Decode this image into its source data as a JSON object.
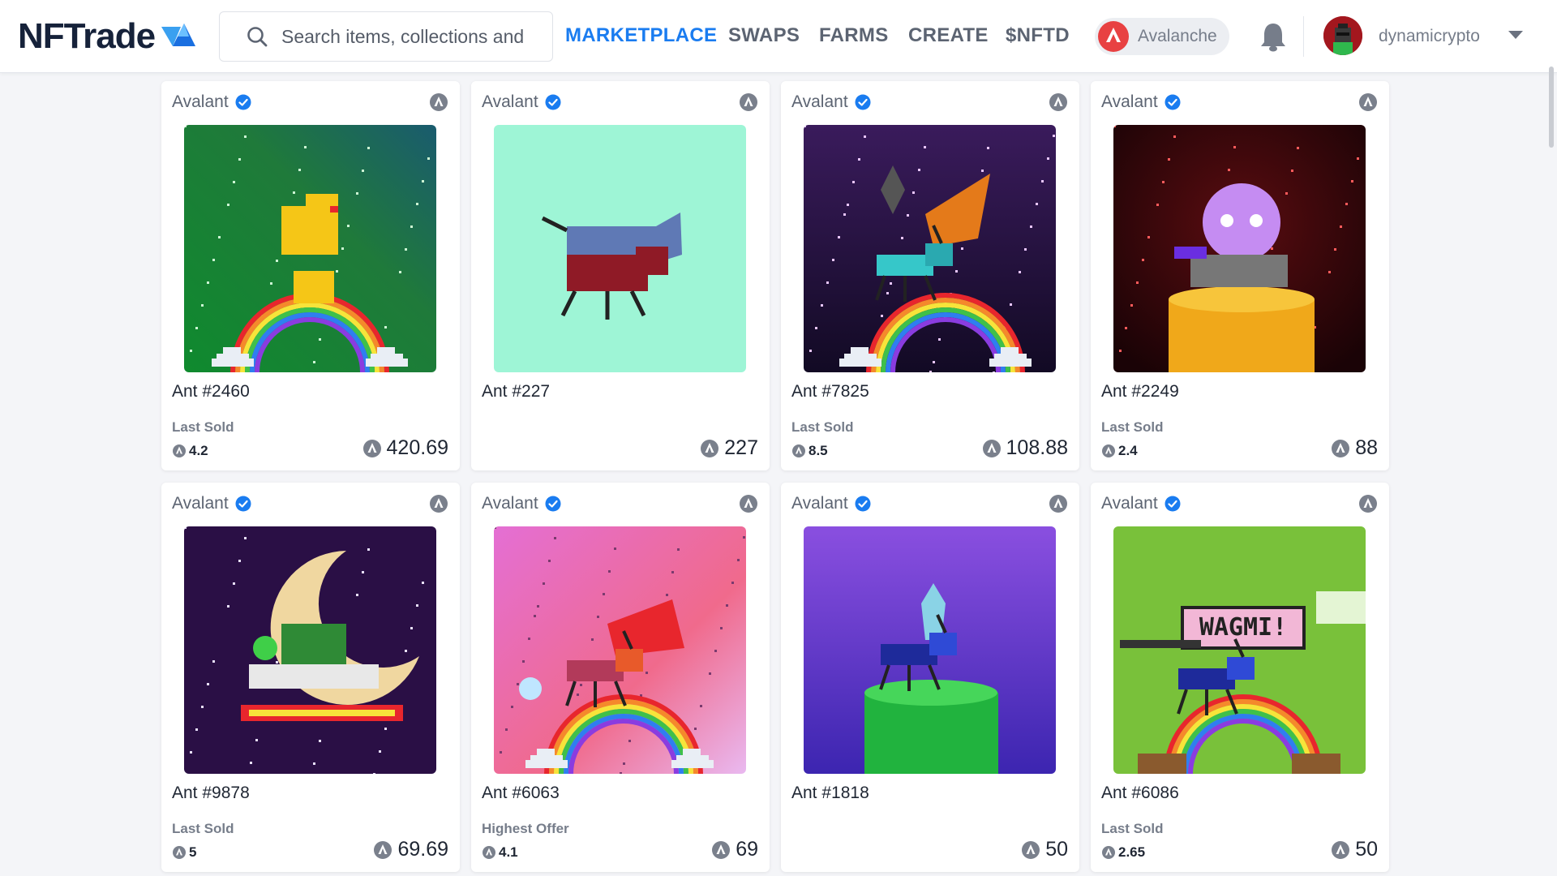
{
  "header": {
    "logo_text": "NFTrade",
    "search_placeholder": "Search items, collections and",
    "nav": [
      "MARKETPLACE",
      "SWAPS",
      "FARMS",
      "CREATE",
      "$NFTD"
    ],
    "active_nav": "MARKETPLACE",
    "chain_label": "Avalanche",
    "username": "dynamicrypto"
  },
  "colors": {
    "accent": "#1a7cf0",
    "avalanche_red": "#e84142",
    "verified_blue": "#1a7cf0"
  },
  "cards": [
    {
      "collection": "Avalant",
      "name": "Ant #2460",
      "sub_label": "Last Sold",
      "sub_value": "4.2",
      "price": "420.69"
    },
    {
      "collection": "Avalant",
      "name": "Ant #227",
      "sub_label": "",
      "sub_value": "",
      "price": "227"
    },
    {
      "collection": "Avalant",
      "name": "Ant #7825",
      "sub_label": "Last Sold",
      "sub_value": "8.5",
      "price": "108.88"
    },
    {
      "collection": "Avalant",
      "name": "Ant #2249",
      "sub_label": "Last Sold",
      "sub_value": "2.4",
      "price": "88"
    },
    {
      "collection": "Avalant",
      "name": "Ant #9878",
      "sub_label": "Last Sold",
      "sub_value": "5",
      "price": "69.69"
    },
    {
      "collection": "Avalant",
      "name": "Ant #6063",
      "sub_label": "Highest Offer",
      "sub_value": "4.1",
      "price": "69"
    },
    {
      "collection": "Avalant",
      "name": "Ant #1818",
      "sub_label": "",
      "sub_value": "",
      "price": "50"
    },
    {
      "collection": "Avalant",
      "name": "Ant #6086",
      "sub_label": "Last Sold",
      "sub_value": "2.65",
      "price": "50"
    }
  ],
  "image_texts": {
    "card_7_sign": "WAGMI!"
  }
}
